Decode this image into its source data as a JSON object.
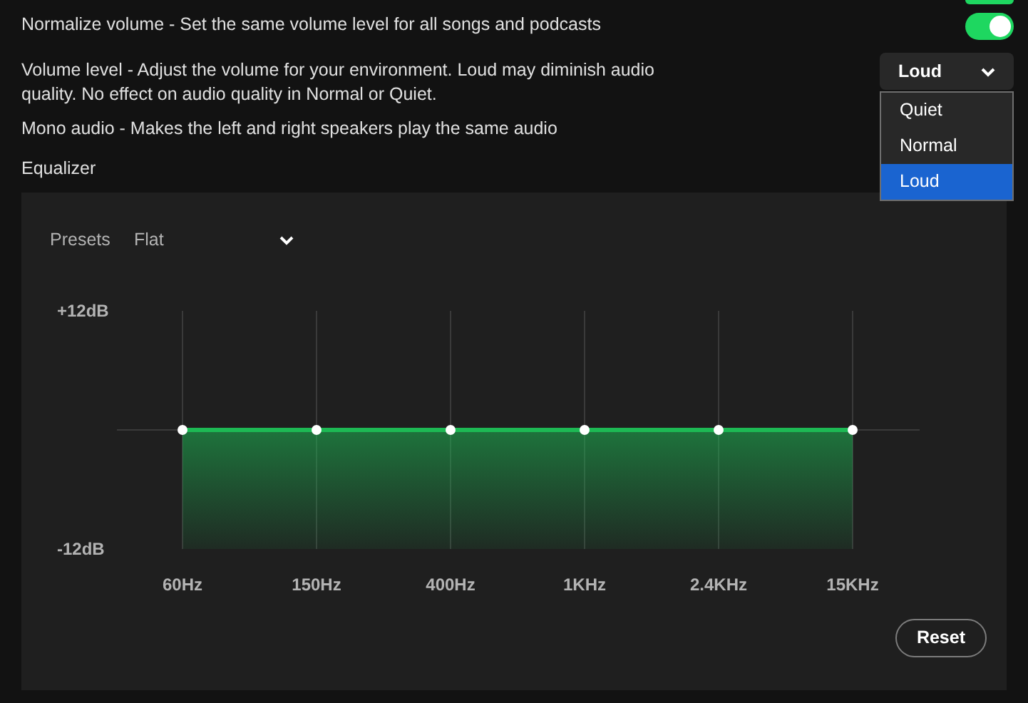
{
  "top_toggle": {
    "on": true
  },
  "settings": [
    {
      "label": "Normalize volume - Set the same volume level for all songs and podcasts",
      "kind": "toggle",
      "on": true
    },
    {
      "label": "Volume level - Adjust the volume for your environment. Loud may diminish audio quality. No effect on audio quality in Normal or Quiet.",
      "kind": "dropdown",
      "value": "Loud",
      "expanded": true,
      "options": [
        {
          "label": "Quiet",
          "selected": false
        },
        {
          "label": "Normal",
          "selected": false
        },
        {
          "label": "Loud",
          "selected": true
        }
      ]
    },
    {
      "label": "Mono audio - Makes the left and right speakers play the same audio",
      "kind": "plain"
    }
  ],
  "equalizer": {
    "title": "Equalizer",
    "presets_label": "Presets",
    "preset": "Flat",
    "reset": "Reset",
    "chart_data": {
      "type": "line",
      "grid": true,
      "categories": [
        "60Hz",
        "150Hz",
        "400Hz",
        "1KHz",
        "2.4KHz",
        "15KHz"
      ],
      "series": [
        {
          "color": "#1db954",
          "marker": "circle",
          "values": [
            0,
            0,
            0,
            0,
            0,
            0
          ]
        }
      ],
      "ylim": [
        -12,
        12
      ],
      "yticks": [
        {
          "value": 12,
          "label": "+12dB"
        },
        {
          "value": -12,
          "label": "-12dB"
        }
      ]
    }
  }
}
